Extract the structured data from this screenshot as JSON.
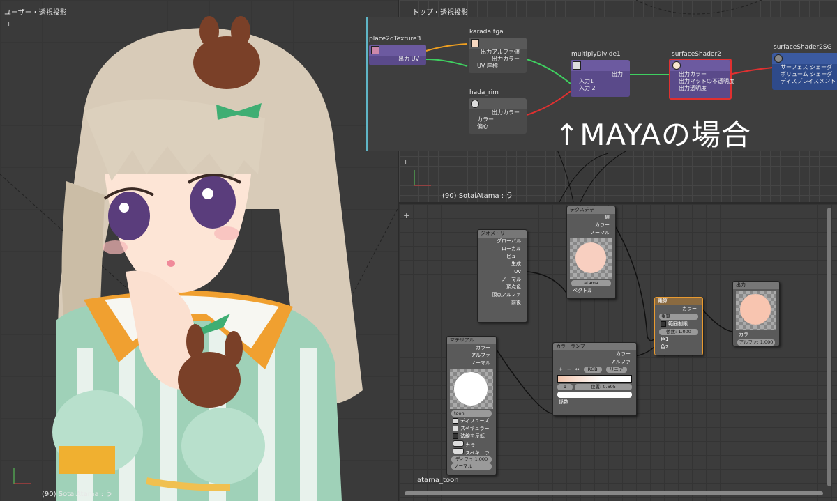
{
  "left_viewport": {
    "title": "ユーザー・透視投影",
    "object_label": "(90) SotaiAtama : う"
  },
  "right_viewport": {
    "title": "トップ・透視投影",
    "object_label": "(90) SotaiAtama : う"
  },
  "maya": {
    "caption": "↑MAYAの場合",
    "nodes": {
      "place2d": {
        "name": "place2dTexture3",
        "rows": [
          "出力 UV"
        ]
      },
      "karada": {
        "name": "karada.tga",
        "rows": [
          "出力アルファ値",
          "出力カラー",
          "UV 座標"
        ]
      },
      "hada": {
        "name": "hada_rim",
        "rows": [
          "出力カラー",
          "カラー",
          "偏心"
        ]
      },
      "multiply": {
        "name": "multiplyDivide1",
        "rows": [
          "出力",
          "入力1",
          "入力 2"
        ]
      },
      "surface": {
        "name": "surfaceShader2",
        "rows": [
          "出力カラー",
          "出力マットの不透明度",
          "出力透明度"
        ]
      },
      "sg": {
        "name": "surfaceShader2SG",
        "rows": [
          "サーフェス シェーダ",
          "ボリューム シェーダ",
          "ディスプレイスメント シェーダ"
        ]
      }
    }
  },
  "blender": {
    "material_name": "atama_toon",
    "nodes": {
      "texture": {
        "title": "テクスチャ",
        "outputs": [
          "値",
          "カラー",
          "ノーマル"
        ],
        "image": "atama",
        "input": "ベクトル"
      },
      "geometry": {
        "title": "ジオメトリ",
        "outputs": [
          "グローバル",
          "ローカル",
          "ビュー",
          "生成",
          "UV",
          "ノーマル",
          "頂点色",
          "頂点アルファ",
          "前後"
        ]
      },
      "multiply": {
        "title": "乗算",
        "output": "カラー",
        "mode": "乗算",
        "clamp_label": "範囲制限",
        "factor": "係数:",
        "factor_value": "1.000",
        "in1": "色1",
        "in2": "色2"
      },
      "output": {
        "title": "出力",
        "input": "カラー",
        "alpha": "アルファ:",
        "alpha_value": "1.000"
      },
      "material": {
        "title": "マテリアル",
        "outputs": [
          "カラー",
          "アルファ",
          "ノーマル"
        ],
        "mat": "toon",
        "checks": [
          "ディフューズ",
          "スペキュラー",
          "法線を反転"
        ],
        "inputs": [
          "カラー",
          "スペキュラ"
        ],
        "diffuse": "ディフュ:1.000",
        "normal_out": "ノーマル"
      },
      "ramp": {
        "title": "カラーランプ",
        "outputs": [
          "カラー",
          "アルファ"
        ],
        "mode1": "RGB",
        "mode2": "リニア",
        "index": "1",
        "position_label": "位置:",
        "position": "0.605",
        "input": "係数"
      }
    }
  }
}
